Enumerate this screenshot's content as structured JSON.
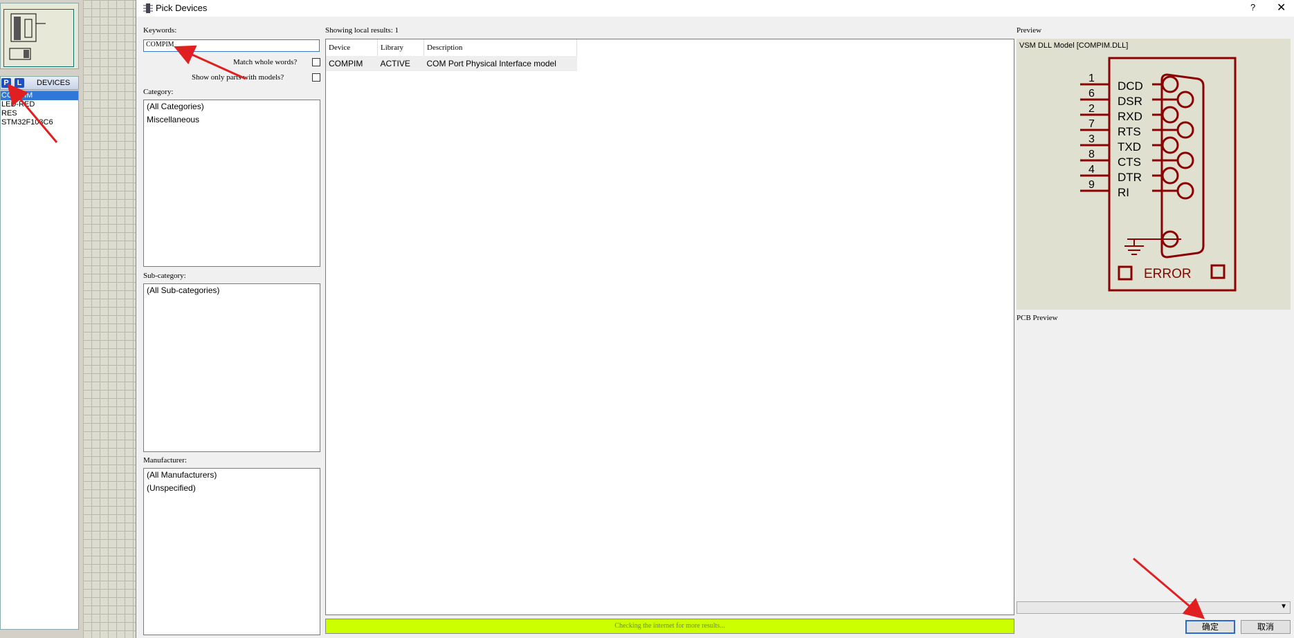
{
  "left_panel": {
    "pl_buttons": [
      "P",
      "L"
    ],
    "header_label": "DEVICES",
    "devices": [
      "COMPIM",
      "LED-RED",
      "RES",
      "STM32F103C6"
    ],
    "selected_device": "COMPIM"
  },
  "dialog": {
    "title": "Pick Devices",
    "help": "?",
    "close": "✕",
    "keywords_label": "Keywords:",
    "keywords_value": "COMPIM",
    "match_whole_words_label": "Match whole words?",
    "show_only_parts_label": "Show only parts with models?",
    "category_label": "Category:",
    "categories": [
      "(All Categories)",
      "Miscellaneous"
    ],
    "subcategory_label": "Sub-category:",
    "subcategories": [
      "(All Sub-categories)"
    ],
    "manufacturer_label": "Manufacturer:",
    "manufacturers": [
      "(All Manufacturers)",
      "(Unspecified)"
    ],
    "results_label": "Showing local results: 1",
    "results": {
      "columns": [
        "Device",
        "Library",
        "Description"
      ],
      "rows": [
        [
          "COMPIM",
          "ACTIVE",
          "COM Port Physical Interface model"
        ]
      ]
    },
    "status_text": "Checking the internet for more results...",
    "preview_label": "Preview",
    "preview_model": "VSM DLL Model [COMPIM.DLL]",
    "schematic": {
      "pins": [
        {
          "num": "1",
          "name": "DCD"
        },
        {
          "num": "6",
          "name": "DSR"
        },
        {
          "num": "2",
          "name": "RXD"
        },
        {
          "num": "7",
          "name": "RTS"
        },
        {
          "num": "3",
          "name": "TXD"
        },
        {
          "num": "8",
          "name": "CTS"
        },
        {
          "num": "4",
          "name": "DTR"
        },
        {
          "num": "9",
          "name": "RI"
        }
      ],
      "error_text": "ERROR",
      "color": "#8b0000"
    },
    "pcb_preview_label": "PCB Preview",
    "ok_button": "确定",
    "cancel_button": "取消"
  },
  "colors": {
    "status_bg": "#ccff00",
    "accent": "#2a6ad0",
    "arrow": "#e02020"
  }
}
